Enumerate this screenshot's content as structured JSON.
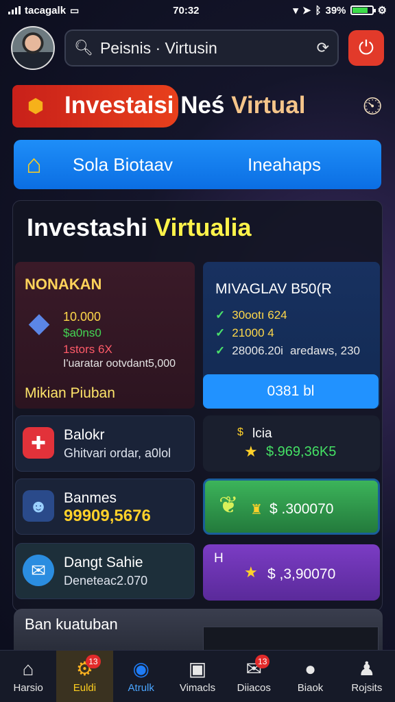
{
  "status_bar": {
    "carrier": "tacagalk",
    "time": "70:32",
    "battery": "39%"
  },
  "header": {
    "search_text": "Peisnis · Virtusin"
  },
  "title": {
    "part1": "Investaisi Neś",
    "part2": "Virtual"
  },
  "banner": {
    "left_text": "Sola Biotaav",
    "right_text": "Ineahaps"
  },
  "panel": {
    "title_a": "Investashi",
    "title_b": "Virtualia",
    "card_a": {
      "heading": "NONAKAN",
      "value1": "10.000",
      "value2": "$a0ns0",
      "value3": "1stors 6X",
      "note": "I'uaratar ootvdant5,000",
      "footer": "Mikian Piuban"
    },
    "card_b": {
      "heading": "MIVAGLAV B50(R",
      "rows": [
        {
          "primary": "30ootı 624",
          "secondary": ""
        },
        {
          "primary": "21000 4",
          "secondary": ""
        },
        {
          "primary": "28006.20i",
          "secondary": "aredaws, 230"
        }
      ],
      "button": "0381 bl"
    },
    "tiles": [
      {
        "title": "Balokr",
        "subtitle": "Ghitvari ordar, a0lol",
        "icon": "gift-icon"
      },
      {
        "title": "Banmes",
        "subtitle": "99909,5676",
        "icon": "people-icon"
      },
      {
        "title": "Dangt Sahie",
        "subtitle": "Deneteac2.070",
        "icon": "mail-icon"
      }
    ],
    "tiles_right": [
      {
        "label": "lcia",
        "amount": "$.969,36K5",
        "color": "#1a2338"
      },
      {
        "label": "",
        "amount": "$ .300070",
        "color": "#2e9a45"
      },
      {
        "label": "H",
        "amount": "$ ,3,90070",
        "color": "#5a2a9a"
      }
    ]
  },
  "bottom_strip": {
    "title": "Ban kuatuban"
  },
  "nav": [
    {
      "label": "Harsio",
      "icon": "home-icon",
      "badge": ""
    },
    {
      "label": "Euldi",
      "icon": "gear-icon",
      "badge": "13"
    },
    {
      "label": "Atrulk",
      "icon": "compass-icon",
      "badge": ""
    },
    {
      "label": "Vimacls",
      "icon": "grid-icon",
      "badge": ""
    },
    {
      "label": "Diiacos",
      "icon": "messages-icon",
      "badge": "13"
    },
    {
      "label": "Biaok",
      "icon": "chat-icon",
      "badge": ""
    },
    {
      "label": "Rojsits",
      "icon": "profile-icon",
      "badge": ""
    }
  ]
}
